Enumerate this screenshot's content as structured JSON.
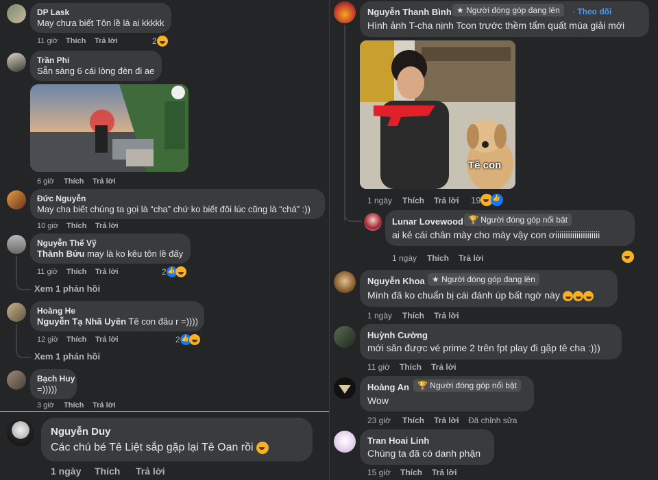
{
  "comments_left": [
    {
      "name": "DP Lask",
      "text": "May chưa biết Tôn lề là ai kkkkk",
      "time": "11 giờ",
      "like": "Thích",
      "reply": "Trả lời",
      "reactions": "2"
    },
    {
      "name": "Trần Phi",
      "text": "Sẵn sàng 6 cái lòng đèn đi ae",
      "time": "6 giờ",
      "like": "Thích",
      "reply": "Trả lời"
    },
    {
      "name": "Đức Nguyễn",
      "text": "May cha biết chúng ta gọi là “cha” chứ ko biết đôi lúc cũng là “chá” :))",
      "time": "10 giờ",
      "like": "Thích",
      "reply": "Trả lời"
    },
    {
      "name": "Nguyễn Thế Vỹ",
      "mention": "Thành Bửu",
      "text": " may là ko kêu tôn lề đấy",
      "time": "11 giờ",
      "like": "Thích",
      "reply": "Trả lời",
      "reactions": "2",
      "replies_link": "Xem 1 phản hồi"
    },
    {
      "name": "Hoàng He",
      "mention": "Nguyễn Tạ Nhã Uyên",
      "text": " Tê con đâu r =))))",
      "time": "12 giờ",
      "like": "Thích",
      "reply": "Trả lời",
      "reactions": "2",
      "replies_link": "Xem 1 phản hồi"
    },
    {
      "name": "Bạch Huy",
      "text": "=)))))",
      "time": "3 giờ",
      "like": "Thích",
      "reply": "Trả lời"
    }
  ],
  "comment_bottom": {
    "name": "Nguyễn Duy",
    "text": "Các chú bé Tê Liệt sắp gặp lại Tê Oan rồi",
    "time": "1 ngày",
    "like": "Thích",
    "reply": "Trả lời"
  },
  "comments_right": [
    {
      "name": "Nguyễn Thanh Bình",
      "badge": "Người đóng góp đang lên",
      "follow": "Theo dõi",
      "text": "Hình ảnh T-cha nịnh Tcon trước thềm tẩm quất mùa giải mới",
      "image_caption": "Tê con",
      "time": "1 ngày",
      "like": "Thích",
      "reply": "Trả lời",
      "reactions": "19"
    },
    {
      "name": "Lunar Lovewood",
      "badge": "Người đóng góp nổi bật",
      "text": "ai kẻ cái chân mày cho mày vậy con ơiiiiiiiiiiiiiiiiiiiii",
      "time": "1 ngày",
      "like": "Thích",
      "reply": "Trả lời"
    },
    {
      "name": "Nguyễn Khoa",
      "badge": "Người đóng góp đang lên",
      "text": "Mình đã ko chuẩn bị cái đánh úp bất ngờ này",
      "time": "1 ngày",
      "like": "Thích",
      "reply": "Trả lời"
    },
    {
      "name": "Huỳnh Cường",
      "text": "mới săn được vé prime 2 trên fpt play đi gặp tê cha :)))",
      "time": "11 giờ",
      "like": "Thích",
      "reply": "Trả lời"
    },
    {
      "name": "Hoàng An",
      "badge": "Người đóng góp nổi bật",
      "text": "Wow",
      "time": "23 giờ",
      "like": "Thích",
      "reply": "Trả lời",
      "edited": "Đã chỉnh sửa"
    },
    {
      "name": "Tran Hoai Linh",
      "text": "Chúng ta đã có danh phận",
      "time": "15 giờ",
      "like": "Thích",
      "reply": "Trả lời"
    }
  ],
  "colors": {
    "bg": "#242526",
    "bubble": "#3a3b3c",
    "text": "#e4e6eb",
    "meta": "#b0b3b8",
    "link": "#4599ff"
  }
}
